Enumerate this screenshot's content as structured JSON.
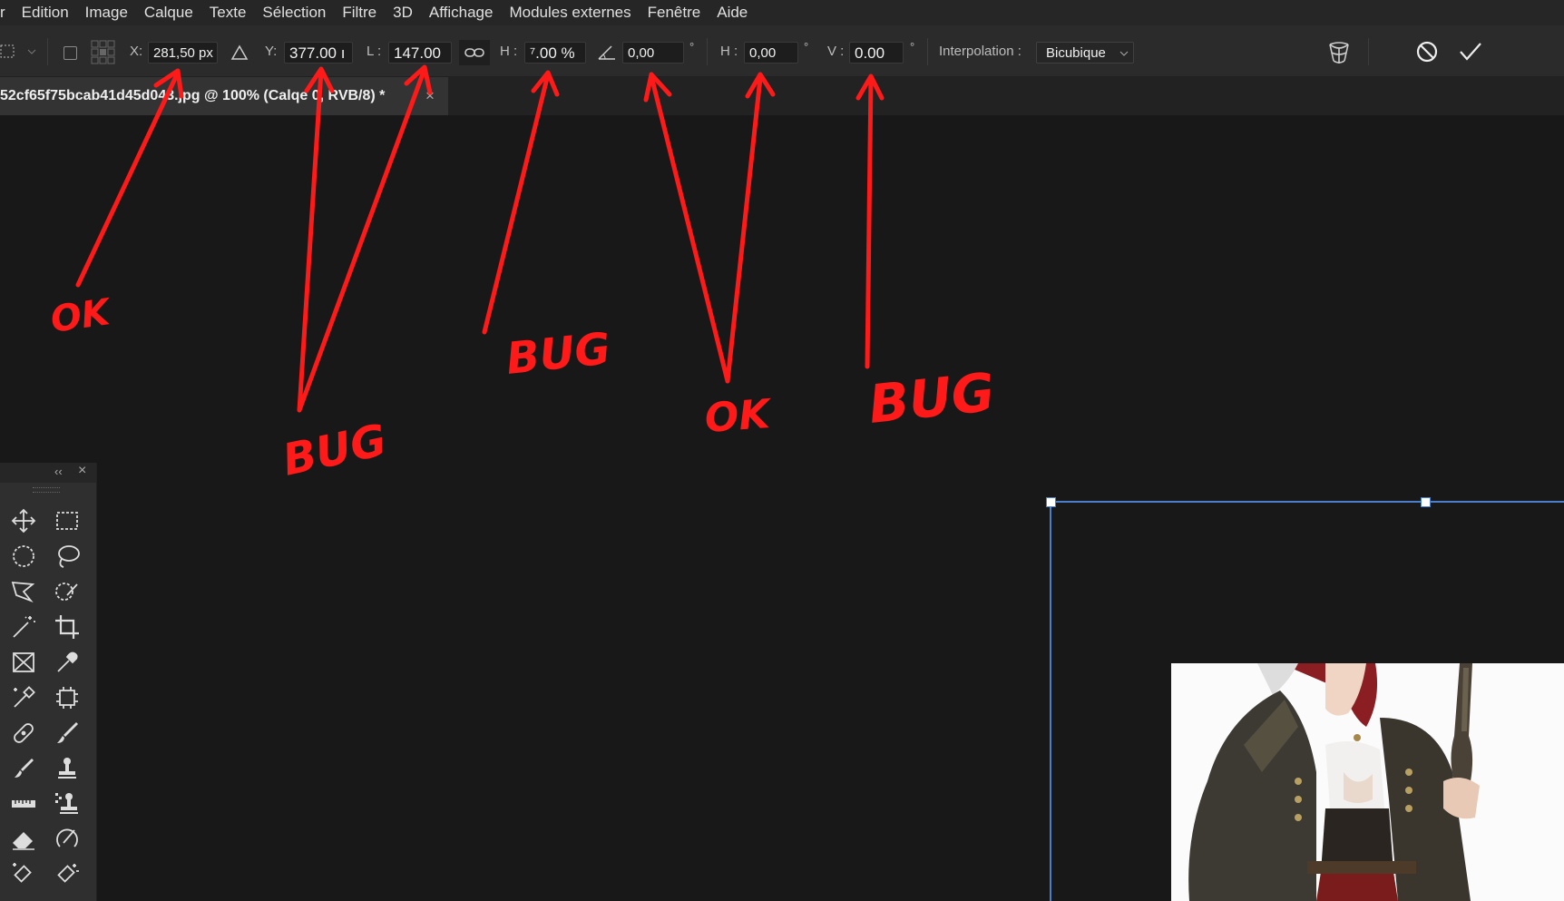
{
  "menu": [
    "r",
    "Edition",
    "Image",
    "Calque",
    "Texte",
    "Sélection",
    "Filtre",
    "3D",
    "Affichage",
    "Modules externes",
    "Fenêtre",
    "Aide"
  ],
  "options": {
    "x_label": "X:",
    "x_value": "281,50 px",
    "y_label": "Y:",
    "y_value": "377.00 ı",
    "w_label": "L :",
    "w_value": "147.00",
    "h_label": "H :",
    "h_value": "⁷.00 %",
    "angle_value": "0,00",
    "skew_h_label": "H :",
    "skew_h_value": "0,00",
    "skew_v_label": "V :",
    "skew_v_value": "0.00",
    "deg": "°",
    "interp_label": "Interpolation :",
    "interp_value": "Bicubique"
  },
  "document_tab": {
    "title": "52cf65f75bcab41d45d0​43.jpg @ 100% (Calq​e 0, RVB/8) *",
    "close": "×"
  },
  "panel": {
    "collapse": "‹‹",
    "close": "×"
  },
  "annotations": {
    "ok1": "OK",
    "bug1": "BUG",
    "bug2": "BUG",
    "ok2": "OK",
    "bug3": "BUG",
    "color": "#ff1a1a"
  },
  "icons": {
    "marquee": "marquee-icon",
    "reference": "reference-point-icon",
    "delta": "delta-icon",
    "link": "link-icon",
    "angle": "angle-icon",
    "warp": "warp-icon",
    "cancel": "cancel-icon",
    "commit": "check-icon"
  },
  "colors": {
    "selection": "#4c7fc9",
    "annotation": "#ff1a1a",
    "menubar": "#262626",
    "optbar": "#2b2b2b"
  }
}
